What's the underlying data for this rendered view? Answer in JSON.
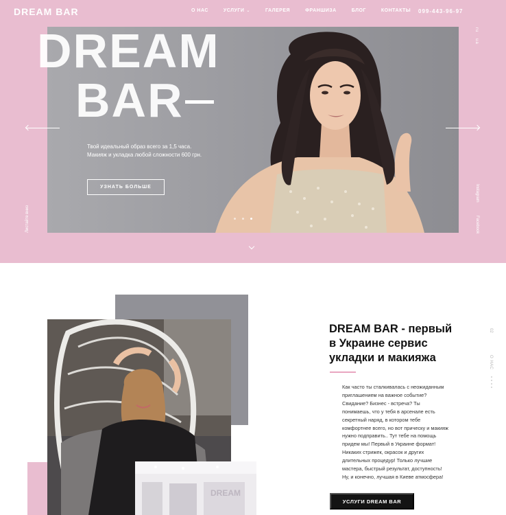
{
  "header": {
    "logo": "DREAM BAR",
    "menu": [
      "О НАС",
      "УСЛУГИ",
      "ГАЛЕРЕЯ",
      "ФРАНШИЗА",
      "БЛОГ",
      "КОНТАКТЫ"
    ],
    "phone": "099-443-96-97"
  },
  "hero": {
    "title_line1": "DREAM",
    "title_line2": "BAR",
    "tagline": "Твой идеальный образ всего за 1,5 часа. Макияж и укладка любой сложности 600 грн.",
    "button_label": "УЗНАТЬ БОЛЬШЕ",
    "languages": [
      "ru",
      "ua"
    ],
    "social": [
      "Instagram",
      "Facebook"
    ],
    "left_vertical": "Листайте вниз",
    "slides_total": 3,
    "active_slide": 3
  },
  "about": {
    "title": "DREAM BAR - первый в Украине сервис укладки и макияжа",
    "text": "Как часто ты сталкивалась с неожиданным приглашением на важное событие? Свидание? Бизнес - встреча? Ты понимаешь, что у тебя в арсенале есть секретный наряд, в котором тебе комфортнее всего, но вот прическу и макияж нужно подправить.. Тут тебе на помощь придем мы! Первый в Украине формат! Никаких стрижек, окрасок и других длительных процедур! Только лучшие мастера, быстрый результат, доступность! Ну, и конечно, лучшая в Киеве атмосфера!",
    "button_label": "УСЛУГИ DREAM BAR",
    "section_index": "02",
    "section_label": "О НАС"
  },
  "colors": {
    "pink": "#e9bdd0",
    "gray": "#919197",
    "dark": "#141414"
  }
}
